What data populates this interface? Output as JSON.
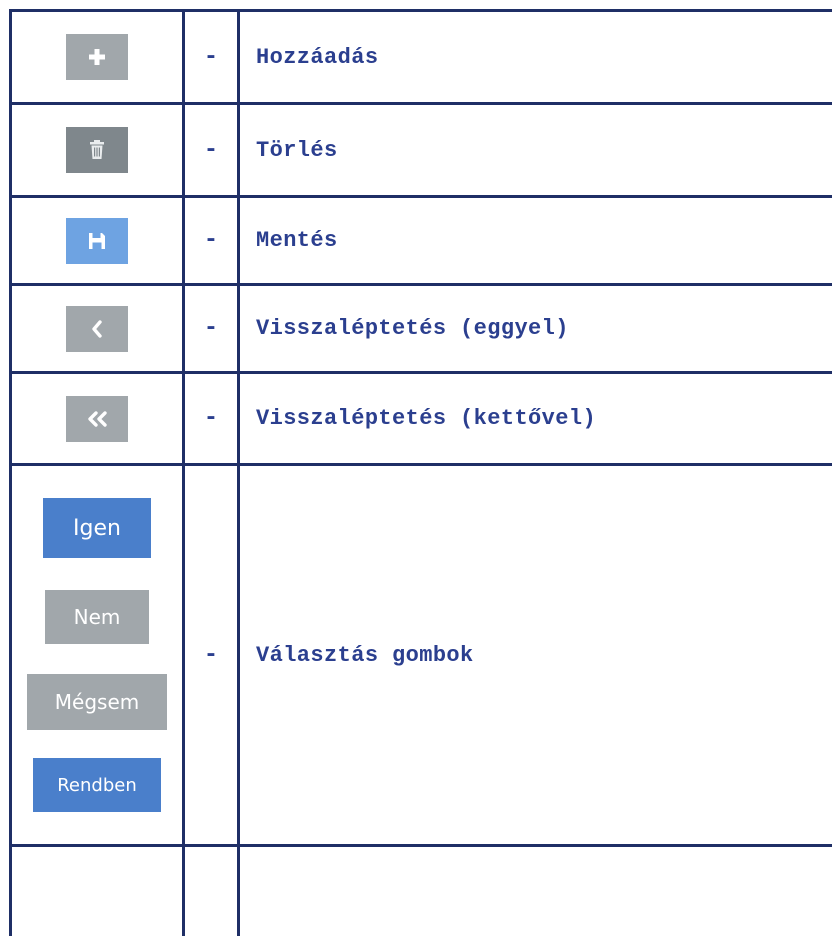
{
  "dash": "-",
  "rows": [
    {
      "icon": "plus-icon",
      "label": "Hozzáadás"
    },
    {
      "icon": "trash-icon",
      "label": "Törlés"
    },
    {
      "icon": "save-icon",
      "label": "Mentés"
    },
    {
      "icon": "chevron-left-icon",
      "label": "Visszaléptetés (eggyel)"
    },
    {
      "icon": "double-chevron-left-icon",
      "label": "Visszaléptetés (kettővel)"
    }
  ],
  "choices": {
    "label": "Választás gombok",
    "buttons": {
      "yes": "Igen",
      "no": "Nem",
      "cancel": "Mégsem",
      "ok": "Rendben"
    }
  },
  "colors": {
    "grid": "#1f2f66",
    "text": "#2b3f8f",
    "gray_button": "#a1a7ab",
    "dark_gray_button": "#7f878c",
    "blue_button": "#4a7fcb",
    "light_blue_button": "#6ea3e2"
  }
}
